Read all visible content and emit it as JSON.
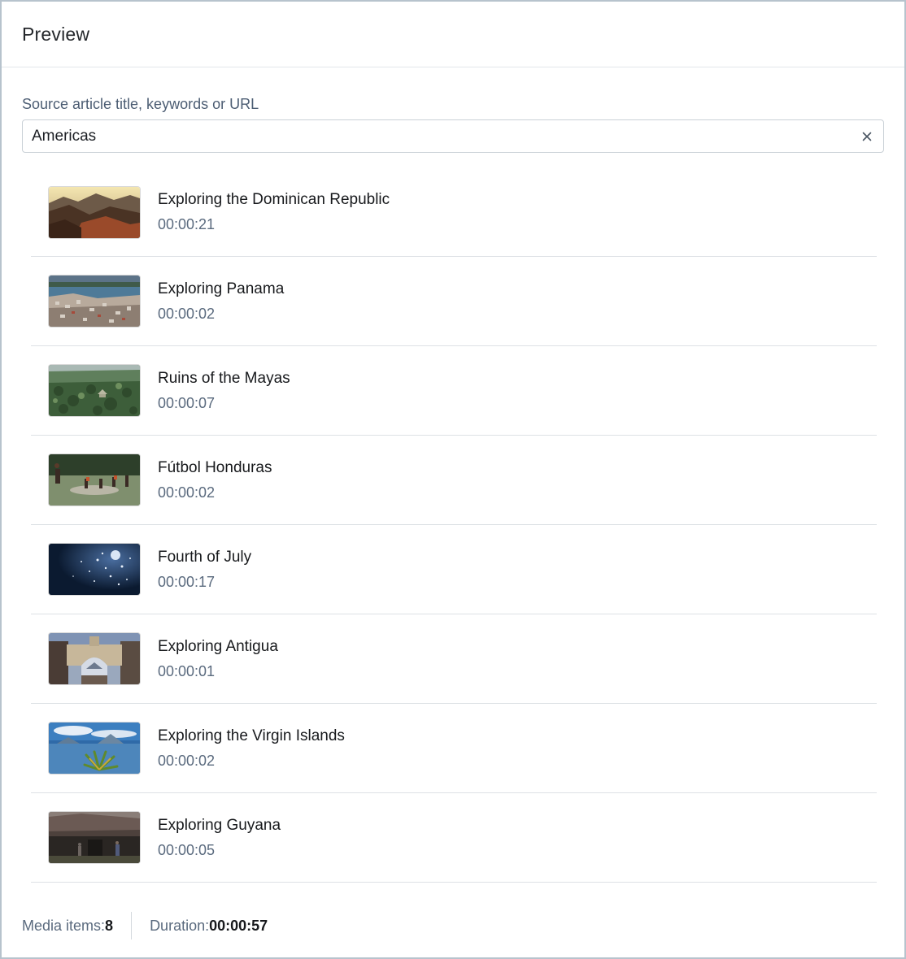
{
  "header": {
    "title": "Preview"
  },
  "search": {
    "label": "Source article title, keywords or URL",
    "value": "Americas",
    "clear_icon": "close-icon"
  },
  "media": [
    {
      "title": "Exploring the Dominican Republic",
      "duration": "00:00:21",
      "thumb": "mountain-valley-thumbnail"
    },
    {
      "title": "Exploring Panama",
      "duration": "00:00:02",
      "thumb": "coastal-city-thumbnail"
    },
    {
      "title": "Ruins of the Mayas",
      "duration": "00:00:07",
      "thumb": "jungle-ruins-thumbnail"
    },
    {
      "title": "Fútbol Honduras",
      "duration": "00:00:02",
      "thumb": "football-players-thumbnail"
    },
    {
      "title": "Fourth of July",
      "duration": "00:00:17",
      "thumb": "fireworks-thumbnail"
    },
    {
      "title": "Exploring Antigua",
      "duration": "00:00:01",
      "thumb": "arch-street-thumbnail"
    },
    {
      "title": "Exploring the Virgin Islands",
      "duration": "00:00:02",
      "thumb": "lake-palm-thumbnail"
    },
    {
      "title": "Exploring Guyana",
      "duration": "00:00:05",
      "thumb": "village-hut-thumbnail"
    }
  ],
  "footer": {
    "items_label": "Media items: ",
    "items_value": "8",
    "duration_label": "Duration: ",
    "duration_value": "00:00:57"
  },
  "colors": {
    "panel_border": "#b7c3cd",
    "label_text": "#4c5d73",
    "secondary_text": "#5a6a7e",
    "divider": "#dde1e5"
  }
}
